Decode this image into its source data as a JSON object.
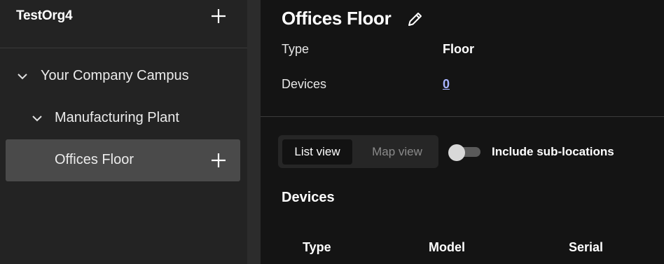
{
  "sidebar": {
    "org_name": "TestOrg4",
    "tree": [
      {
        "label": "Your Company Campus",
        "expanded": true
      },
      {
        "label": "Manufacturing Plant",
        "expanded": true
      },
      {
        "label": "Offices Floor",
        "selected": true
      }
    ]
  },
  "main": {
    "title": "Offices Floor",
    "properties": {
      "type_label": "Type",
      "type_value": "Floor",
      "devices_label": "Devices",
      "devices_value": "0"
    },
    "view_toggle": {
      "list_label": "List view",
      "map_label": "Map view",
      "selected": "List view"
    },
    "include_sublocations": {
      "label": "Include sub-locations",
      "enabled": false
    },
    "devices_section": {
      "title": "Devices",
      "columns": [
        "Type",
        "Model",
        "Serial"
      ]
    }
  },
  "colors": {
    "sidebar_bg": "#232323",
    "main_bg": "#141414",
    "selected_item_bg": "#4a4a4a",
    "link": "#a8b4ff"
  },
  "icons": {
    "add": "plus-icon",
    "expand": "chevron-down-icon",
    "edit": "pencil-icon"
  }
}
